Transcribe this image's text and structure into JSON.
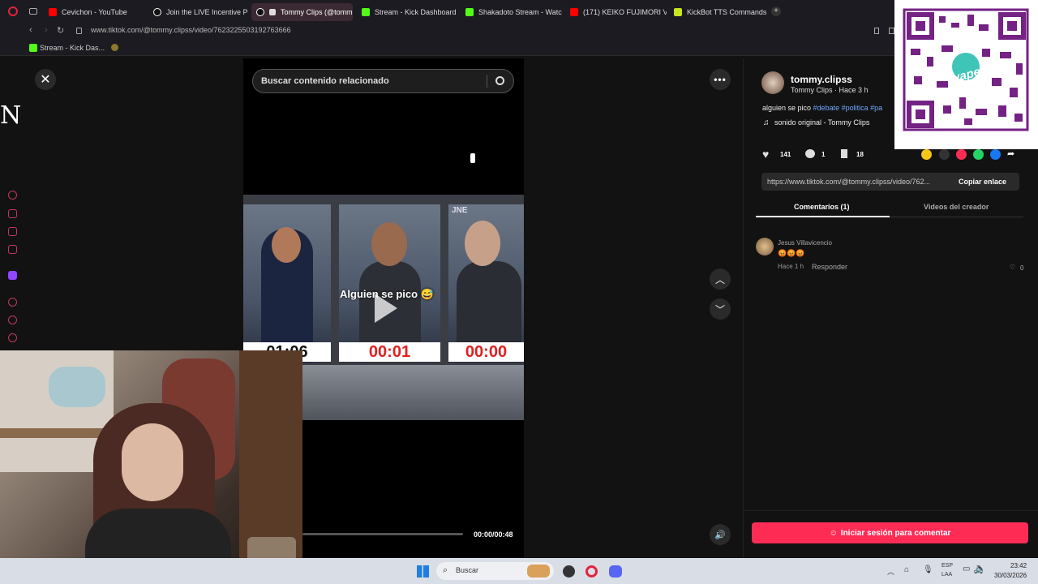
{
  "browser": {
    "tabs": [
      {
        "label": "Cevichon - YouTube",
        "icon": "youtube-icon",
        "color": "#ff0000"
      },
      {
        "label": "Join the LIVE Incentive Pr",
        "icon": "tiktok-icon",
        "color": "#ffffff"
      },
      {
        "label": "Tommy Clips (@tomm",
        "icon": "tiktok-icon",
        "color": "#ffffff",
        "active": true
      },
      {
        "label": "Stream - Kick Dashboard",
        "icon": "kick-icon",
        "color": "#53fc18"
      },
      {
        "label": "Shakadoto Stream - Watc",
        "icon": "kick-icon",
        "color": "#53fc18"
      },
      {
        "label": "(171) KEIKO FUJIMORI VS.",
        "icon": "youtube-icon",
        "color": "#ff0000"
      },
      {
        "label": "KickBot TTS Commands",
        "icon": "kickbot-icon",
        "color": "#c8e61e"
      }
    ],
    "url": "www.tiktok.com/@tommy.clipss/video/7623225503192763666",
    "bookmarks": [
      {
        "label": "Stream - Kick Das...",
        "icon": "kick-icon"
      }
    ]
  },
  "tiktok": {
    "search_placeholder": "Buscar contenido relacionado",
    "video": {
      "caption_overlay": "Alguien se pico 😅",
      "timers": [
        "01:06",
        "00:01",
        "00:00"
      ],
      "badge": "JNE",
      "time": "00:00/00:48",
      "progress": 0.0
    },
    "author": {
      "username": "tommy.clipss",
      "meta": "Tommy Clips · Hace 3 h",
      "description_prefix": "alguien se pico ",
      "hashtags": [
        "#debate",
        "#politica",
        "#pa"
      ],
      "sound": "sonido original - Tommy Clips"
    },
    "stats": {
      "likes": "141",
      "comments": "1",
      "saves": "18"
    },
    "link": {
      "url": "https://www.tiktok.com/@tommy.clipss/video/762...",
      "copy_label": "Copiar enlace"
    },
    "tabs": [
      {
        "label": "Comentarios (1)",
        "active": true
      },
      {
        "label": "Videos del creador",
        "active": false
      }
    ],
    "comment": {
      "author": "Jesus Villavicencio",
      "text": "😡😡😡",
      "time": "Hace 1 h",
      "reply_label": "Responder",
      "likes": "0"
    },
    "login_button": "Iniciar sesión para comentar",
    "accent": "#fe2c55"
  },
  "overlay": {
    "left_letter": "N",
    "qr_brand": "yape",
    "qr_color": "#742284"
  },
  "taskbar": {
    "search_label": "Buscar",
    "lang": "ESP",
    "lang_sub": "LAA",
    "time": "23:42",
    "date": "30/03/2026"
  }
}
